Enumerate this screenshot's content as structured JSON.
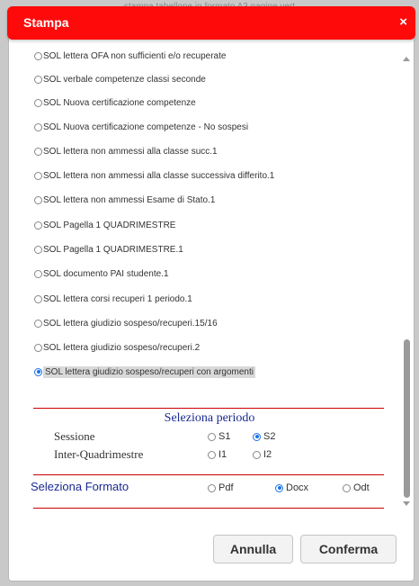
{
  "backdrop": {
    "text": "stampa tabellone in formato A3 pagine vert"
  },
  "dialog": {
    "title": "Stampa",
    "close_glyph": "×"
  },
  "options": [
    {
      "label": "SOL lettera OFA non sufficienti e/o recuperate",
      "selected": false
    },
    {
      "label": "SOL verbale competenze classi seconde",
      "selected": false
    },
    {
      "label": "SOL Nuova certificazione competenze",
      "selected": false
    },
    {
      "label": "SOL Nuova certificazione competenze - No sospesi",
      "selected": false
    },
    {
      "label": "SOL lettera non ammessi alla classe succ.1",
      "selected": false
    },
    {
      "label": "SOL lettera non ammessi alla classe successiva differito.1",
      "selected": false
    },
    {
      "label": "SOL lettera non ammessi Esame di Stato.1",
      "selected": false
    },
    {
      "label": "SOL Pagella 1 QUADRIMESTRE",
      "selected": false
    },
    {
      "label": "SOL Pagella 1 QUADRIMESTRE.1",
      "selected": false
    },
    {
      "label": "SOL documento PAI studente.1",
      "selected": false
    },
    {
      "label": "SOL lettera corsi recuperi 1 periodo.1",
      "selected": false
    },
    {
      "label": "SOL lettera giudizio sospeso/recuperi.15/16",
      "selected": false
    },
    {
      "label": "SOL lettera giudizio sospeso/recuperi.2",
      "selected": false
    },
    {
      "label": "SOL lettera giudizio sospeso/recuperi con argomenti",
      "selected": true
    }
  ],
  "period": {
    "title": "Seleziona periodo",
    "sessione": {
      "label": "Sessione",
      "opt1": "S1",
      "opt2": "S2",
      "selected": "S2"
    },
    "inter": {
      "label": "Inter-Quadrimestre",
      "opt1": "I1",
      "opt2": "I2",
      "selected": ""
    }
  },
  "format": {
    "title": "Seleziona Formato",
    "opt1": "Pdf",
    "opt2": "Docx",
    "opt3": "Odt",
    "selected": "Docx"
  },
  "buttons": {
    "cancel": "Annulla",
    "confirm": "Conferma"
  },
  "colors": {
    "titlebar": "#ff0a0a",
    "accent_blue": "#1a2a90",
    "divider": "#cc0000"
  }
}
